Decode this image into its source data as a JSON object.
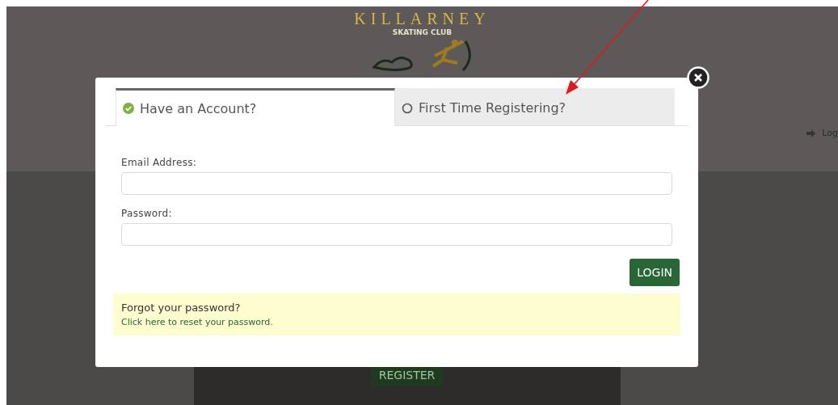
{
  "background": {
    "logo": {
      "name": "KILLARNEY",
      "subtitle": "SKATING CLUB"
    },
    "login_link": "Log",
    "register_button": "REGISTER"
  },
  "modal": {
    "tabs": [
      {
        "label": "Have an Account?",
        "selected": true
      },
      {
        "label": "First Time Registering?",
        "selected": false
      }
    ],
    "fields": [
      {
        "label": "Email Address:"
      },
      {
        "label": "Password:"
      }
    ],
    "login_button": "LOGIN",
    "forgot": {
      "title": "Forgot your password?",
      "link": "Click here to reset your password."
    }
  }
}
